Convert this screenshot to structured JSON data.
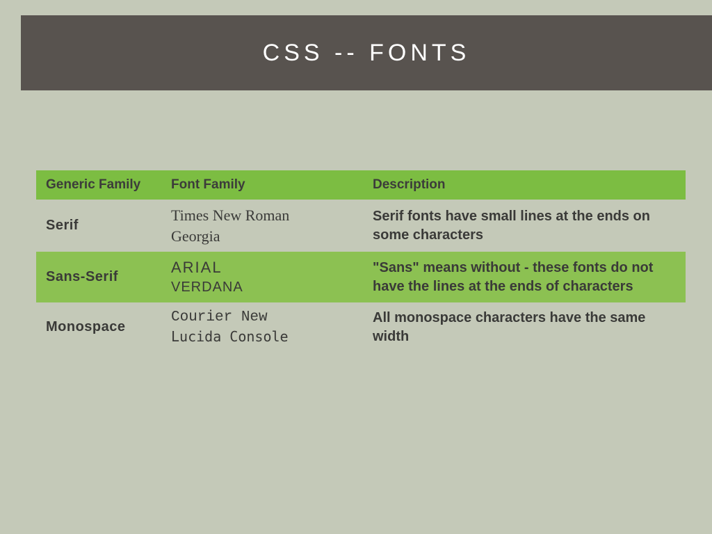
{
  "title": "CSS -- FONTS",
  "headers": {
    "generic": "Generic family",
    "family": "Font family",
    "description": "Description"
  },
  "rows": [
    {
      "generic": "Serif",
      "family1": "Times New Roman",
      "family2": "Georgia",
      "description": "Serif fonts have small lines at the ends on some characters"
    },
    {
      "generic": "Sans-serif",
      "family1": "Arial",
      "family2": "Verdana",
      "description": "\"Sans\" means without - these fonts do not have the lines at the ends of characters"
    },
    {
      "generic": "Monospace",
      "family1": "Courier New",
      "family2": "Lucida Console",
      "description": "All monospace characters have the same width"
    }
  ]
}
